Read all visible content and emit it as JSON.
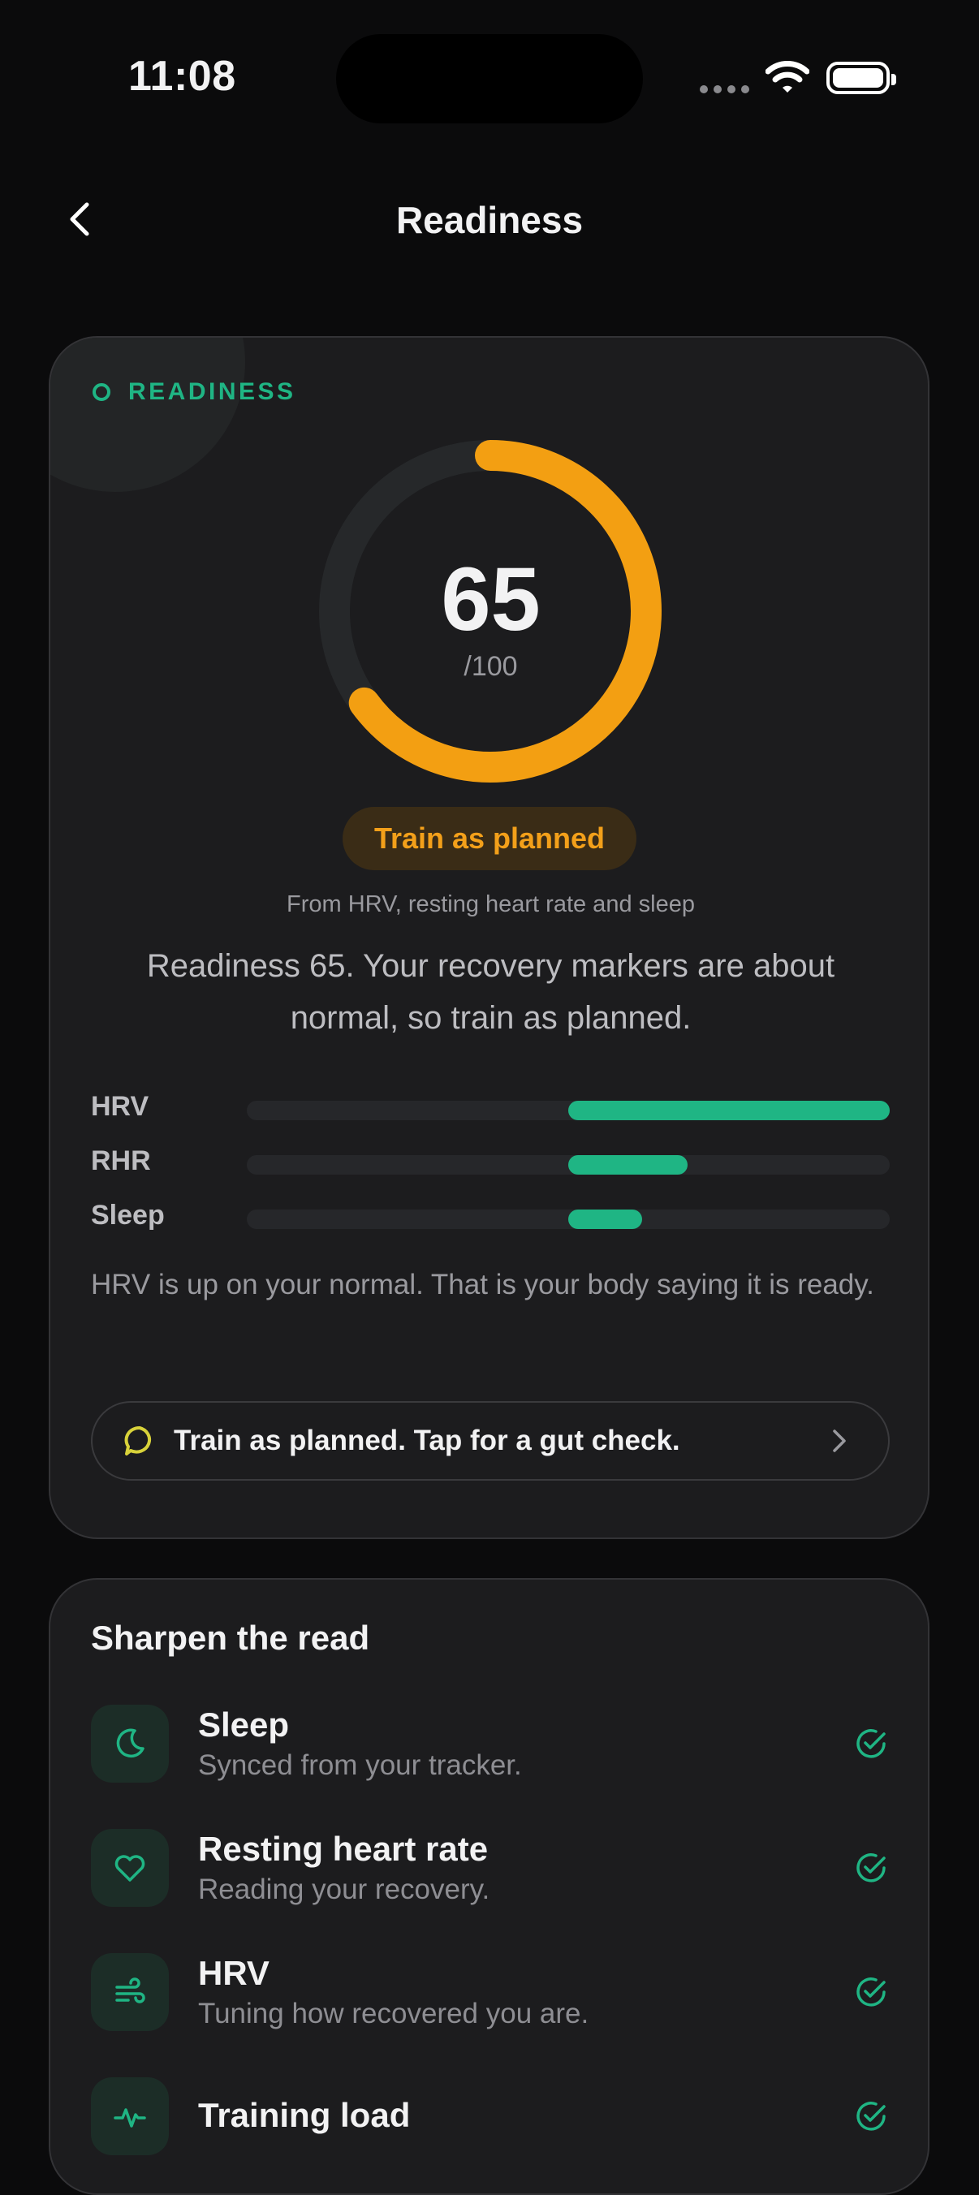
{
  "status_bar": {
    "time": "11:08"
  },
  "header": {
    "title": "Readiness"
  },
  "readiness_card": {
    "eyebrow": "READINESS",
    "score": "65",
    "score_max": "/100",
    "score_fraction": 0.65,
    "status_label": "Train as planned",
    "source_text": "From HRV, resting heart rate and sleep",
    "summary": "Readiness 65. Your recovery markers are about normal, so train as planned.",
    "metrics": [
      {
        "label": "HRV",
        "deviation": 1.0
      },
      {
        "label": "RHR",
        "deviation": 0.37
      },
      {
        "label": "Sleep",
        "deviation": 0.23
      }
    ],
    "insight": "HRV is up on your normal. That is your body saying it is ready.",
    "cta_label": "Train as planned. Tap for a gut check."
  },
  "sharpen_card": {
    "title": "Sharpen the read",
    "items": [
      {
        "title": "Sleep",
        "subtitle": "Synced from your tracker.",
        "icon": "moon-icon"
      },
      {
        "title": "Resting heart rate",
        "subtitle": "Reading your recovery.",
        "icon": "heart-icon"
      },
      {
        "title": "HRV",
        "subtitle": "Tuning how recovered you are.",
        "icon": "wind-icon"
      },
      {
        "title": "Training load",
        "subtitle": "",
        "icon": "pulse-icon"
      }
    ]
  },
  "colors": {
    "accent_green": "#1fb584",
    "accent_orange": "#f3a01a",
    "cta_icon_yellow": "#d8d23a"
  }
}
